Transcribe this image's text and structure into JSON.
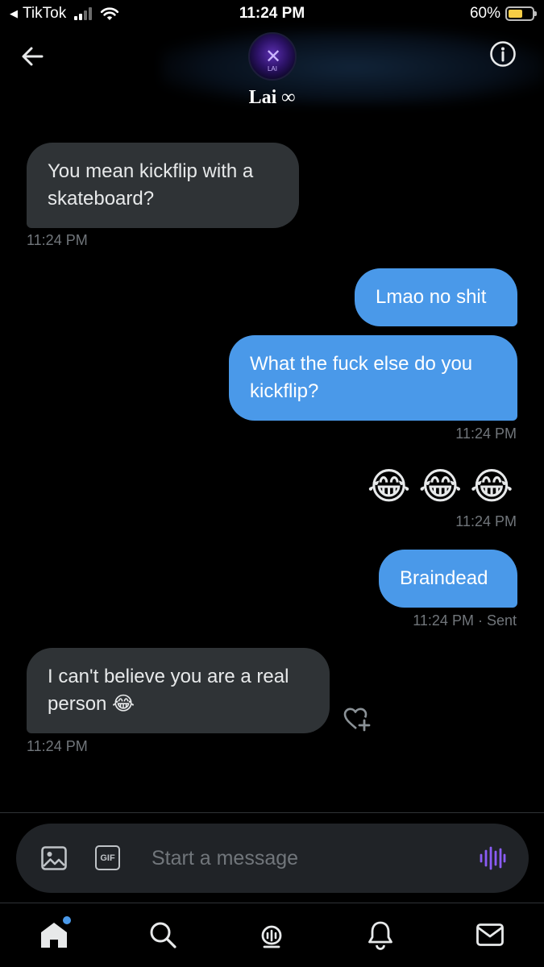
{
  "status_bar": {
    "back_app": "TikTok",
    "time": "11:24 PM",
    "battery_percent": "60%",
    "battery_level": 0.6,
    "battery_color": "#f7ce46"
  },
  "header": {
    "contact_name": "Lai ∞",
    "avatar_text": "LAI",
    "back_icon": "arrow-left-icon",
    "info_icon": "info-circle-icon"
  },
  "colors": {
    "incoming_bubble": "#2f3336",
    "outgoing_bubble": "#4a99e9",
    "timestamp": "#71767b",
    "voice_accent": "#8b5cf6"
  },
  "messages": [
    {
      "direction": "incoming",
      "text": "You mean kickflip with a skateboard?",
      "line1": "You mean kickflip with a",
      "line2": "skateboard?",
      "time": "11:24 PM"
    },
    {
      "direction": "outgoing",
      "text": "Lmao no shit"
    },
    {
      "direction": "outgoing",
      "text": "What the fuck else do you kickflip?",
      "line1": "What the fuck else do you",
      "line2": "kickflip?",
      "time": "11:24 PM"
    },
    {
      "direction": "outgoing",
      "text": "😂😂😂",
      "emojis": [
        "😂",
        "😂",
        "😂"
      ],
      "time": "11:24 PM"
    },
    {
      "direction": "outgoing",
      "text": "Braindead",
      "time": "11:24 PM",
      "status": "· Sent"
    },
    {
      "direction": "incoming",
      "text": "I can't believe you are a real person 😂",
      "line1": "I can't believe you are a real",
      "line2": "person 😂",
      "time": "11:24 PM"
    }
  ],
  "composer": {
    "placeholder": "Start a message",
    "gif_label": "GIF",
    "image_icon": "image-icon",
    "voice_icon": "voice-waveform-icon"
  },
  "tabbar": {
    "items": [
      "home-icon",
      "search-icon",
      "spaces-icon",
      "notifications-icon",
      "messages-icon"
    ],
    "home_has_dot": true
  }
}
